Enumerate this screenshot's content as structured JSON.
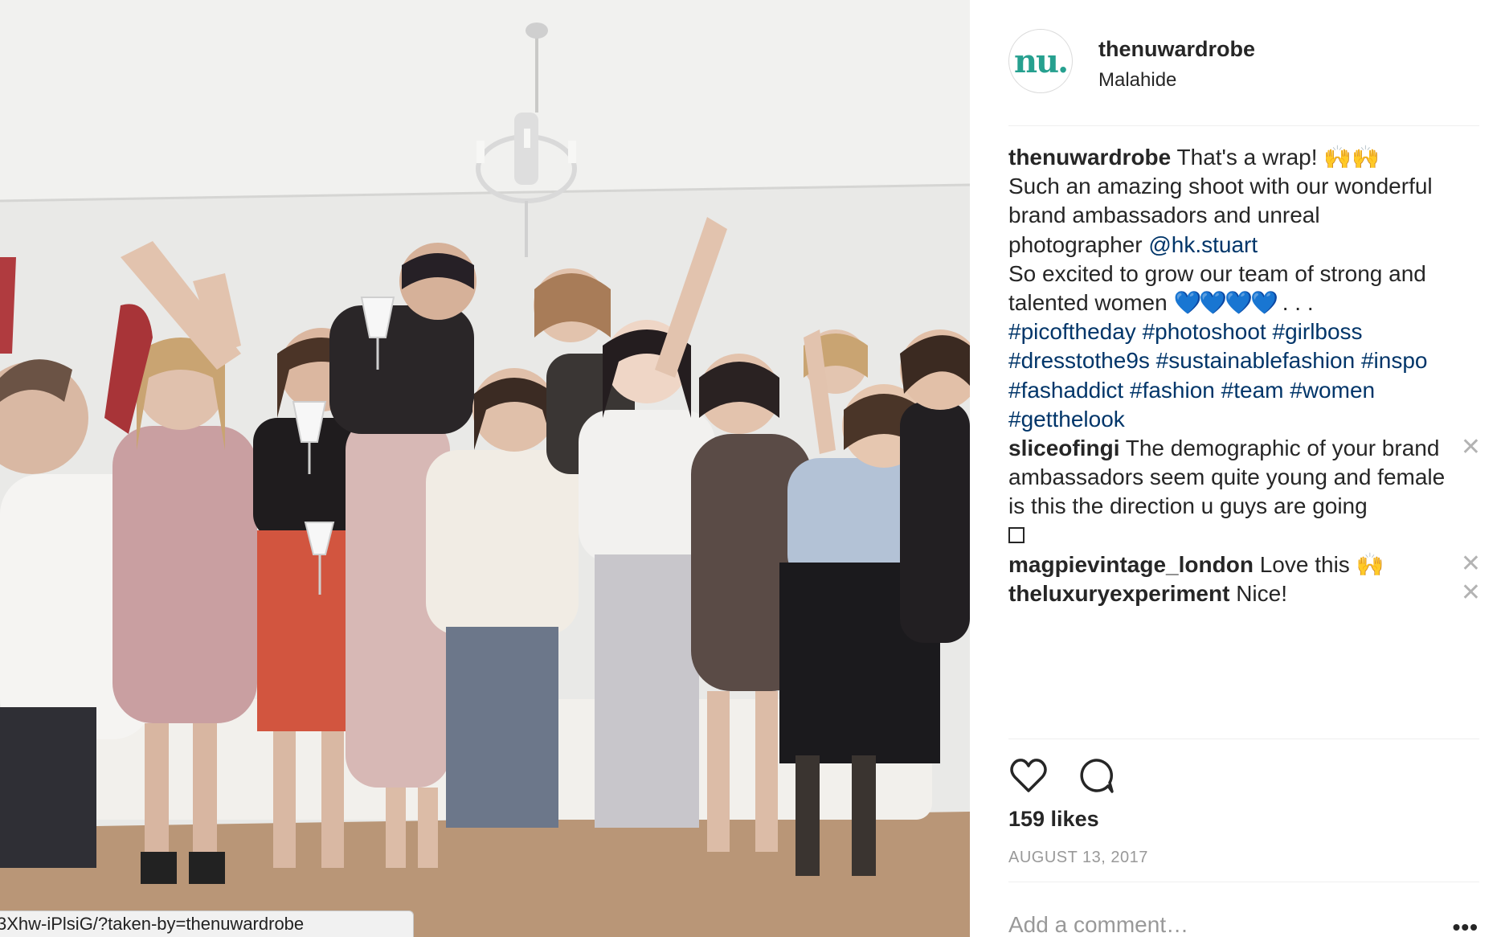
{
  "photo": {
    "alt_url": "3Xhw-iPlsiG/?taken-by=thenuwardrobe"
  },
  "header": {
    "avatar_text": "nu.",
    "username": "thenuwardrobe",
    "location": "Malahide"
  },
  "caption": {
    "username": "thenuwardrobe",
    "line1": "That's a wrap!",
    "line1_emoji": "🙌🙌",
    "line2": "Such an amazing shoot with our wonderful brand ambassadors and unreal photographer",
    "mention": "@hk.stuart",
    "line3": "So excited to grow our team of strong and talented women",
    "hearts": "💙💙💙💙",
    "dots": ". . .",
    "hashtags": [
      "#picoftheday",
      "#photoshoot",
      "#girlboss",
      "#dresstothe9s",
      "#sustainablefashion",
      "#inspo",
      "#fashaddict",
      "#fashion",
      "#team",
      "#women",
      "#getthelook"
    ]
  },
  "comments": [
    {
      "username": "sliceofingi",
      "text": "The demographic of your brand ambassadors seem quite young and female is this the direction u guys are going"
    },
    {
      "username": "magpievintage_london",
      "text": "Love this",
      "emoji": "🙌"
    },
    {
      "username": "theluxuryexperiment",
      "text": "Nice!"
    }
  ],
  "close_glyph": "✕",
  "actions": {
    "likes": "159 likes",
    "date": "AUGUST 13, 2017",
    "add_comment_placeholder": "Add a comment…",
    "more": "•••"
  },
  "icons": [
    "heart-icon",
    "comment-icon",
    "close-icon",
    "more-icon"
  ],
  "colors": {
    "link": "#003569",
    "brand": "#26a08f",
    "muted": "#999999"
  }
}
